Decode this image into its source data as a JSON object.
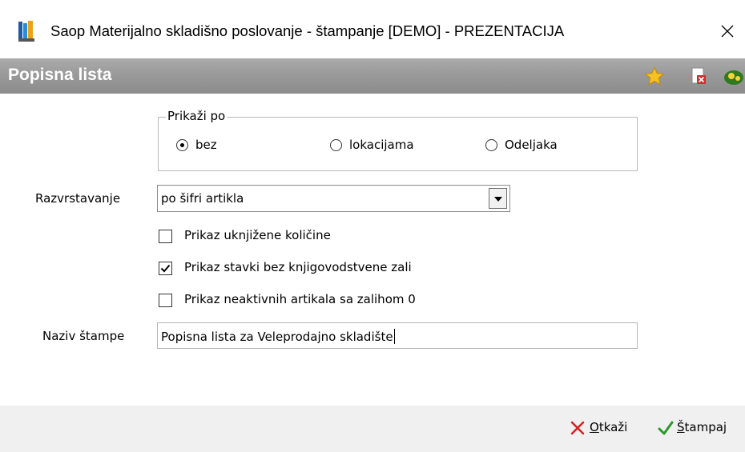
{
  "window": {
    "title": "Saop Materijalno skladišno poslovanje - štampanje [DEMO] - PREZENTACIJA",
    "app_icon": "books-icon",
    "close_icon": "close-icon"
  },
  "header": {
    "title": "Popisna lista",
    "icons": [
      "star-icon",
      "delete-document-icon",
      "help-icon"
    ]
  },
  "prikazi_po": {
    "legend": "Prikaži po",
    "options": [
      {
        "label": "bez",
        "selected": true
      },
      {
        "label": "lokacijama",
        "selected": false
      },
      {
        "label": "Odeljaka",
        "selected": false
      }
    ]
  },
  "razvrstavanje": {
    "label": "Razvrstavanje",
    "value": "po šifri artikla"
  },
  "checkboxes": [
    {
      "label": "Prikaz uknjižene količine",
      "checked": false
    },
    {
      "label": "Prikaz stavki bez knjigovodstvene zali",
      "checked": true
    },
    {
      "label": "Prikaz neaktivnih artikala sa zalihom 0",
      "checked": false
    }
  ],
  "naziv_stampe": {
    "label": "Naziv štampe",
    "value": "Popisna lista za Veleprodajno skladište"
  },
  "footer": {
    "cancel": {
      "accel": "O",
      "rest": "tkaži"
    },
    "print": {
      "accel": "Š",
      "rest": "tampaj"
    }
  },
  "colors": {
    "header_bg": "#9a9a9a",
    "cancel_icon": "#d42020",
    "print_icon": "#2a9a2a",
    "footer_bg": "#f0f0f0"
  }
}
